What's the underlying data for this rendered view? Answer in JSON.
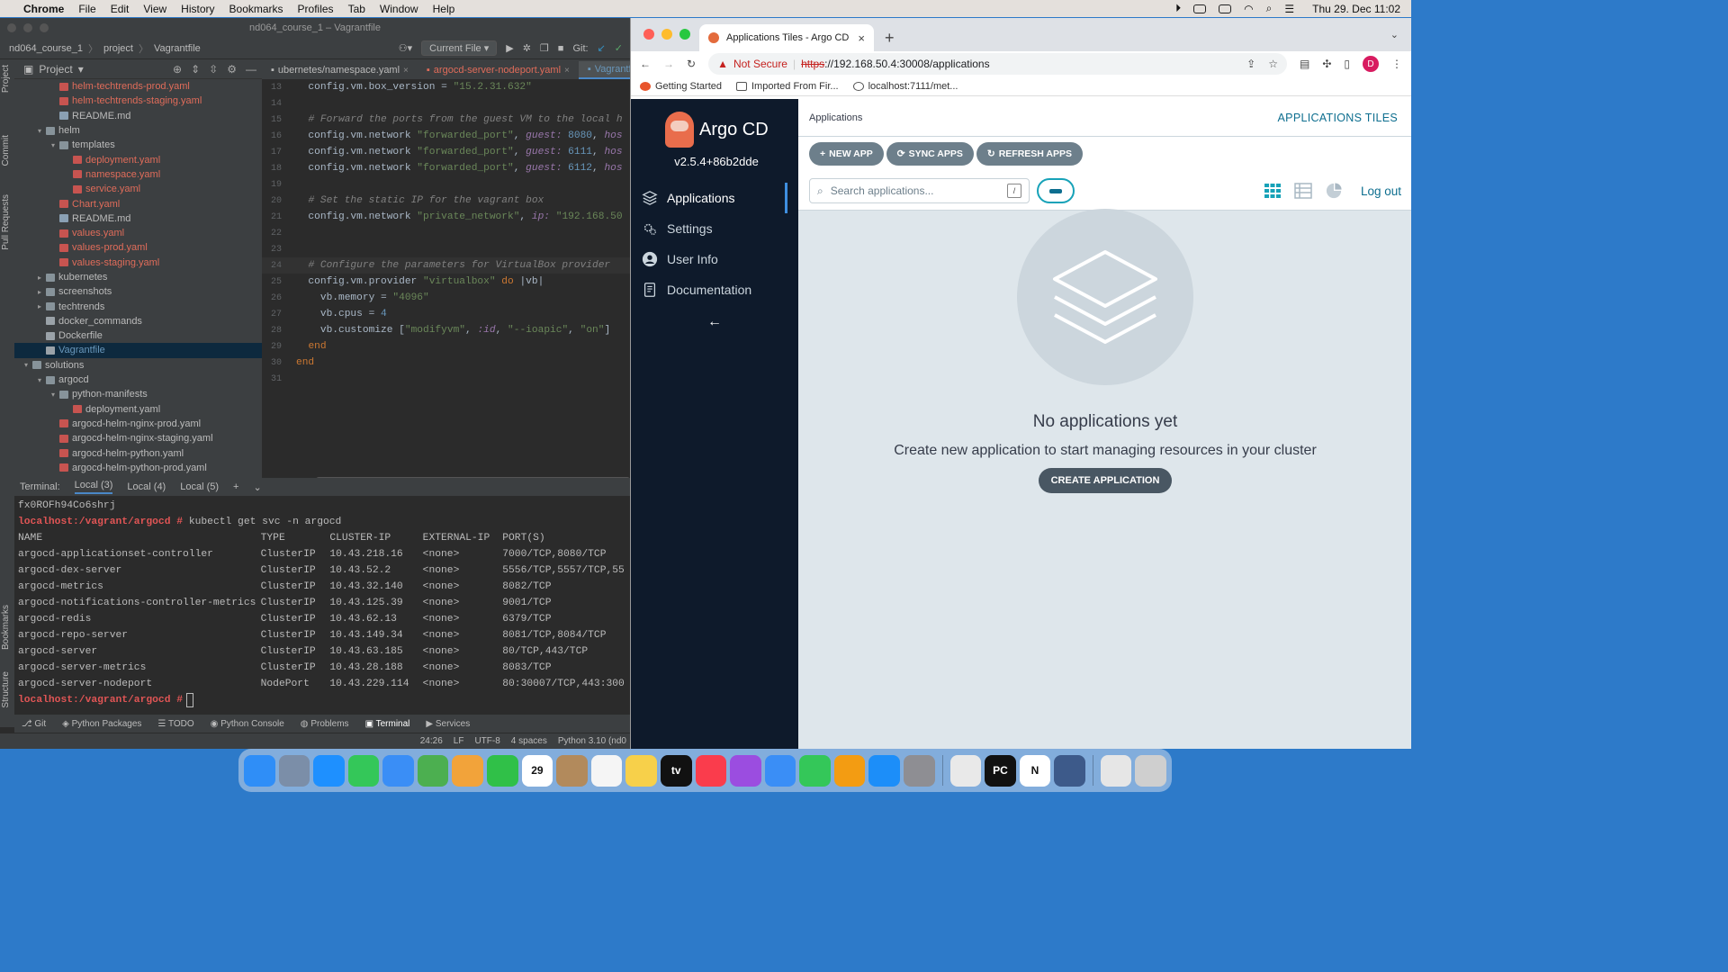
{
  "menubar": {
    "app": "Chrome",
    "items": [
      "File",
      "Edit",
      "View",
      "History",
      "Bookmarks",
      "Profiles",
      "Tab",
      "Window",
      "Help"
    ],
    "clock": "Thu 29. Dec  11:02"
  },
  "ide": {
    "window_title": "nd064_course_1 – Vagrantfile",
    "breadcrumb": [
      "nd064_course_1",
      "project",
      "Vagrantfile"
    ],
    "current_file": "Current File",
    "git_label": "Git:",
    "side_labels": [
      "Project",
      "Commit",
      "Pull Requests",
      "Bookmarks",
      "Structure"
    ],
    "project_panel_title": "Project",
    "tree": [
      {
        "name": "helm-techtrends-prod.yaml",
        "indent": 4,
        "type": "yaml",
        "color": "red"
      },
      {
        "name": "helm-techtrends-staging.yaml",
        "indent": 4,
        "type": "yaml",
        "color": "red"
      },
      {
        "name": "README.md",
        "indent": 4,
        "type": "md",
        "color": ""
      },
      {
        "name": "helm",
        "indent": 3,
        "type": "folder",
        "color": "",
        "twisty": "▾"
      },
      {
        "name": "templates",
        "indent": 4,
        "type": "folder",
        "color": "",
        "twisty": "▾"
      },
      {
        "name": "deployment.yaml",
        "indent": 5,
        "type": "yaml",
        "color": "red"
      },
      {
        "name": "namespace.yaml",
        "indent": 5,
        "type": "yaml",
        "color": "red"
      },
      {
        "name": "service.yaml",
        "indent": 5,
        "type": "yaml",
        "color": "red"
      },
      {
        "name": "Chart.yaml",
        "indent": 4,
        "type": "yaml",
        "color": "red"
      },
      {
        "name": "README.md",
        "indent": 4,
        "type": "md",
        "color": ""
      },
      {
        "name": "values.yaml",
        "indent": 4,
        "type": "yaml",
        "color": "red"
      },
      {
        "name": "values-prod.yaml",
        "indent": 4,
        "type": "yaml",
        "color": "red"
      },
      {
        "name": "values-staging.yaml",
        "indent": 4,
        "type": "yaml",
        "color": "red"
      },
      {
        "name": "kubernetes",
        "indent": 3,
        "type": "folder",
        "color": "",
        "twisty": "▸"
      },
      {
        "name": "screenshots",
        "indent": 3,
        "type": "folder",
        "color": "",
        "twisty": "▸"
      },
      {
        "name": "techtrends",
        "indent": 3,
        "type": "folder",
        "color": "",
        "twisty": "▸"
      },
      {
        "name": "docker_commands",
        "indent": 3,
        "type": "file",
        "color": ""
      },
      {
        "name": "Dockerfile",
        "indent": 3,
        "type": "file",
        "color": ""
      },
      {
        "name": "Vagrantfile",
        "indent": 3,
        "type": "file",
        "color": "blue",
        "selected": true
      },
      {
        "name": "solutions",
        "indent": 2,
        "type": "folder",
        "color": "",
        "twisty": "▾"
      },
      {
        "name": "argocd",
        "indent": 3,
        "type": "folder",
        "color": "",
        "twisty": "▾"
      },
      {
        "name": "python-manifests",
        "indent": 4,
        "type": "folder",
        "color": "",
        "twisty": "▾"
      },
      {
        "name": "deployment.yaml",
        "indent": 5,
        "type": "yaml",
        "color": ""
      },
      {
        "name": "argocd-helm-nginx-prod.yaml",
        "indent": 4,
        "type": "yaml",
        "color": ""
      },
      {
        "name": "argocd-helm-nginx-staging.yaml",
        "indent": 4,
        "type": "yaml",
        "color": ""
      },
      {
        "name": "argocd-helm-python.yaml",
        "indent": 4,
        "type": "yaml",
        "color": ""
      },
      {
        "name": "argocd-helm-python-prod.yaml",
        "indent": 4,
        "type": "yaml",
        "color": ""
      }
    ],
    "tabs": [
      {
        "label": "ubernetes/namespace.yaml",
        "style": ""
      },
      {
        "label": "argocd-server-nodeport.yaml",
        "style": "red"
      },
      {
        "label": "Vagrantfile",
        "style": "blue",
        "active": true
      }
    ],
    "code_lines": [
      {
        "n": "13",
        "html": "  config.vm.box_version = <span class='c-str'>\"15.2.31.632\"</span>"
      },
      {
        "n": "14",
        "html": ""
      },
      {
        "n": "15",
        "html": "  <span class='c-comment'># Forward the ports from the guest VM to the local h</span>"
      },
      {
        "n": "16",
        "html": "  config.vm.network <span class='c-str'>\"forwarded_port\"</span>, <span class='c-sym'>guest:</span> <span class='c-num'>8080</span>, <span class='c-sym'>hos</span>"
      },
      {
        "n": "17",
        "html": "  config.vm.network <span class='c-str'>\"forwarded_port\"</span>, <span class='c-sym'>guest:</span> <span class='c-num'>6111</span>, <span class='c-sym'>hos</span>"
      },
      {
        "n": "18",
        "html": "  config.vm.network <span class='c-str'>\"forwarded_port\"</span>, <span class='c-sym'>guest:</span> <span class='c-num'>6112</span>, <span class='c-sym'>hos</span>"
      },
      {
        "n": "19",
        "html": ""
      },
      {
        "n": "20",
        "html": "  <span class='c-comment'># Set the static IP for the vagrant box</span>"
      },
      {
        "n": "21",
        "html": "  config.vm.network <span class='c-str'>\"private_network\"</span>, <span class='c-sym'>ip:</span> <span class='c-str'>\"192.168.50</span>"
      },
      {
        "n": "22",
        "html": ""
      },
      {
        "n": "23",
        "html": ""
      },
      {
        "n": "24",
        "html": "  <span class='c-comment'># Configure the parameters for VirtualBox provider</span>",
        "current": true
      },
      {
        "n": "25",
        "html": "  config.vm.provider <span class='c-str'>\"virtualbox\"</span> <span class='c-key'>do</span> |vb|"
      },
      {
        "n": "26",
        "html": "    vb.memory = <span class='c-str'>\"4096\"</span>"
      },
      {
        "n": "27",
        "html": "    vb.cpus = <span class='c-num'>4</span>"
      },
      {
        "n": "28",
        "html": "    vb.customize [<span class='c-str'>\"modifyvm\"</span>, <span class='c-sym'>:id</span>, <span class='c-str'>\"--ioapic\"</span>, <span class='c-str'>\"on\"</span>]"
      },
      {
        "n": "29",
        "html": "  <span class='c-key'>end</span>"
      },
      {
        "n": "30",
        "html": "<span class='c-key'>end</span>"
      },
      {
        "n": "31",
        "html": ""
      }
    ],
    "terminal": {
      "label": "Terminal:",
      "tabs": [
        "Local (3)",
        "Local (4)",
        "Local (5)"
      ],
      "first_line": "fx0ROFh94Co6shrj",
      "prompt": "localhost:/vagrant/argocd #",
      "command": " kubectl get svc -n argocd",
      "headers": [
        "NAME",
        "TYPE",
        "CLUSTER-IP",
        "EXTERNAL-IP",
        "PORT(S)"
      ],
      "rows": [
        [
          "argocd-applicationset-controller",
          "ClusterIP",
          "10.43.218.16",
          "<none>",
          "7000/TCP,8080/TCP"
        ],
        [
          "argocd-dex-server",
          "ClusterIP",
          "10.43.52.2",
          "<none>",
          "5556/TCP,5557/TCP,55"
        ],
        [
          "argocd-metrics",
          "ClusterIP",
          "10.43.32.140",
          "<none>",
          "8082/TCP"
        ],
        [
          "argocd-notifications-controller-metrics",
          "ClusterIP",
          "10.43.125.39",
          "<none>",
          "9001/TCP"
        ],
        [
          "argocd-redis",
          "ClusterIP",
          "10.43.62.13",
          "<none>",
          "6379/TCP"
        ],
        [
          "argocd-repo-server",
          "ClusterIP",
          "10.43.149.34",
          "<none>",
          "8081/TCP,8084/TCP"
        ],
        [
          "argocd-server",
          "ClusterIP",
          "10.43.63.185",
          "<none>",
          "80/TCP,443/TCP"
        ],
        [
          "argocd-server-metrics",
          "ClusterIP",
          "10.43.28.188",
          "<none>",
          "8083/TCP"
        ],
        [
          "argocd-server-nodeport",
          "NodePort",
          "10.43.229.114",
          "<none>",
          "80:30007/TCP,443:300"
        ]
      ],
      "final_prompt": "localhost:/vagrant/argocd #"
    },
    "bottom_tools": [
      "Git",
      "Python Packages",
      "TODO",
      "Python Console",
      "Problems",
      "Terminal",
      "Services"
    ],
    "status": [
      "24:26",
      "LF",
      "UTF-8",
      "4 spaces",
      "Python 3.10 (nd0"
    ]
  },
  "chrome": {
    "tab_title": "Applications Tiles - Argo CD",
    "url_warning": "Not Secure",
    "url_proto": "https",
    "url_rest": "://192.168.50.4:30008/applications",
    "avatar": "D",
    "bookmarks": [
      "Getting Started",
      "Imported From Fir...",
      "localhost:7111/met..."
    ]
  },
  "argo": {
    "brand": "Argo CD",
    "version": "v2.5.4+86b2dde",
    "nav": [
      "Applications",
      "Settings",
      "User Info",
      "Documentation"
    ],
    "breadcrumb": "Applications",
    "page_title": "APPLICATIONS TILES",
    "buttons": [
      "NEW APP",
      "SYNC APPS",
      "REFRESH APPS"
    ],
    "search_placeholder": "Search applications...",
    "search_shortcut": "/",
    "logout": "Log out",
    "empty_title": "No applications yet",
    "empty_subtitle": "Create new application to start managing resources in your cluster",
    "create_button": "CREATE APPLICATION"
  },
  "dock": {
    "apps": [
      {
        "name": "finder-icon",
        "color": "#2f8ef7"
      },
      {
        "name": "launchpad-icon",
        "color": "#7b8ea8"
      },
      {
        "name": "safari-icon",
        "color": "#1e90ff"
      },
      {
        "name": "messages-icon",
        "color": "#34c759"
      },
      {
        "name": "mail-icon",
        "color": "#3a8ef6"
      },
      {
        "name": "maps-icon",
        "color": "#4caf50"
      },
      {
        "name": "photos-icon",
        "color": "#f2a33a"
      },
      {
        "name": "facetime-icon",
        "color": "#30c048"
      },
      {
        "name": "calendar-icon",
        "color": "#ffffff",
        "text": "29"
      },
      {
        "name": "contacts-icon",
        "color": "#b28a5c"
      },
      {
        "name": "reminders-icon",
        "color": "#f5f5f5"
      },
      {
        "name": "notes-icon",
        "color": "#f7d04a"
      },
      {
        "name": "appletv-icon",
        "color": "#111111",
        "text": "tv"
      },
      {
        "name": "music-icon",
        "color": "#fa3c4c"
      },
      {
        "name": "podcasts-icon",
        "color": "#9b4de0"
      },
      {
        "name": "keynote-icon",
        "color": "#3a8ef6"
      },
      {
        "name": "numbers-icon",
        "color": "#34c759"
      },
      {
        "name": "pages-icon",
        "color": "#f39c12"
      },
      {
        "name": "appstore-icon",
        "color": "#1c8ef9"
      },
      {
        "name": "system-preferences-icon",
        "color": "#8e8e93"
      },
      {
        "name": "chrome-icon",
        "color": "#e9e9e9"
      },
      {
        "name": "pycharm-icon",
        "color": "#111111",
        "text": "PC"
      },
      {
        "name": "notion-icon",
        "color": "#ffffff",
        "text": "N"
      },
      {
        "name": "virtualbox-icon",
        "color": "#3d5a8a"
      },
      {
        "name": "downloads-icon",
        "color": "#e6e6e6"
      },
      {
        "name": "trash-icon",
        "color": "#cfcfcf"
      }
    ]
  }
}
